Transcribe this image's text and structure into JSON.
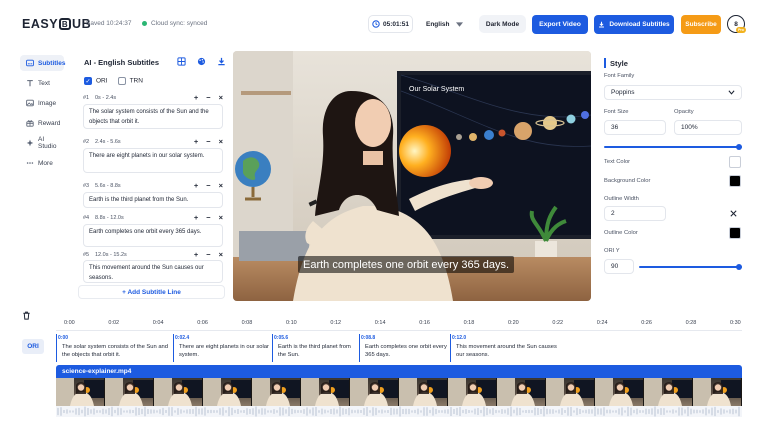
{
  "header": {
    "logo_left": "EASY",
    "logo_b": "B",
    "logo_right": "UB",
    "saved": "Saved 10:24:37",
    "sync": "Cloud sync: synced",
    "timer": "05:01:51",
    "language": "English",
    "dark_mode": "Dark Mode",
    "export": "Export Video",
    "download": "Download Subtitles",
    "subscribe": "Subscribe",
    "avatar": "8",
    "avatar_badge": "Pro"
  },
  "nav": [
    {
      "label": "Subtitles",
      "icon": "subtitles-icon",
      "active": true
    },
    {
      "label": "Text",
      "icon": "text-icon"
    },
    {
      "label": "Image",
      "icon": "image-icon"
    },
    {
      "label": "Reward",
      "icon": "reward-icon"
    },
    {
      "label": "AI Studio",
      "icon": "ai-studio-icon"
    },
    {
      "label": "More",
      "icon": "more-icon"
    }
  ],
  "subtitles_panel": {
    "title": "AI - English Subtitles",
    "ori": "ORI",
    "trn": "TRN",
    "ori_checked": true,
    "trn_checked": false,
    "lines": [
      {
        "num": "#1",
        "time": "0s - 2.4s",
        "text": "The solar system consists of the Sun and the objects that orbit it."
      },
      {
        "num": "#2",
        "time": "2.4s - 5.6s",
        "text": "There are eight planets in our solar system."
      },
      {
        "num": "#3",
        "time": "5.6s - 8.8s",
        "text": "Earth is the third planet from the Sun."
      },
      {
        "num": "#4",
        "time": "8.8s - 12.0s",
        "text": "Earth completes one orbit every 365 days."
      },
      {
        "num": "#5",
        "time": "12.0s - 15.2s",
        "text": "This movement around the Sun causes our seasons."
      }
    ],
    "add_line": "+ Add Subtitle Line"
  },
  "video": {
    "screen_title": "Our Solar System",
    "caption": "Earth completes one orbit every 365 days."
  },
  "style": {
    "title": "Style",
    "font_family_label": "Font Family",
    "font_family": "Poppins",
    "font_size_label": "Font Size",
    "font_size": "36",
    "opacity_label": "Opacity",
    "opacity": "100%",
    "opacity_value": 1.0,
    "text_color_label": "Text Color",
    "text_color": "#ffffff",
    "bg_color_label": "Background Color",
    "bg_color": "#000000",
    "outline_width_label": "Outline Width",
    "outline_width": "2",
    "outline_color_label": "Outline Color",
    "outline_color": "#000000",
    "ori_y_label": "ORI Y",
    "ori_y": "90",
    "ori_y_value": 1.0
  },
  "timeline": {
    "ticks": [
      "0:00",
      "0:02",
      "0:04",
      "0:06",
      "0:08",
      "0:10",
      "0:12",
      "0:14",
      "0:16",
      "0:18",
      "0:20",
      "0:22",
      "0:24",
      "0:26",
      "0:28",
      "0:30"
    ],
    "ori_tag": "ORI",
    "segments": [
      {
        "time": "0:00",
        "text": "The solar system consists of the Sun and the objects that orbit it."
      },
      {
        "time": "0:02.4",
        "text": "There are eight planets in our solar system."
      },
      {
        "time": "0:05.6",
        "text": "Earth is the third planet from the Sun."
      },
      {
        "time": "0:08.8",
        "text": "Earth completes one orbit every 365 days."
      },
      {
        "time": "0:12.0",
        "text": "This movement around the Sun causes our seasons."
      }
    ],
    "track_name": "science-explainer.mp4"
  },
  "colors": {
    "accent": "#1d5be0",
    "subscribe": "#f59b16",
    "sync_dot": "#2bb673"
  }
}
